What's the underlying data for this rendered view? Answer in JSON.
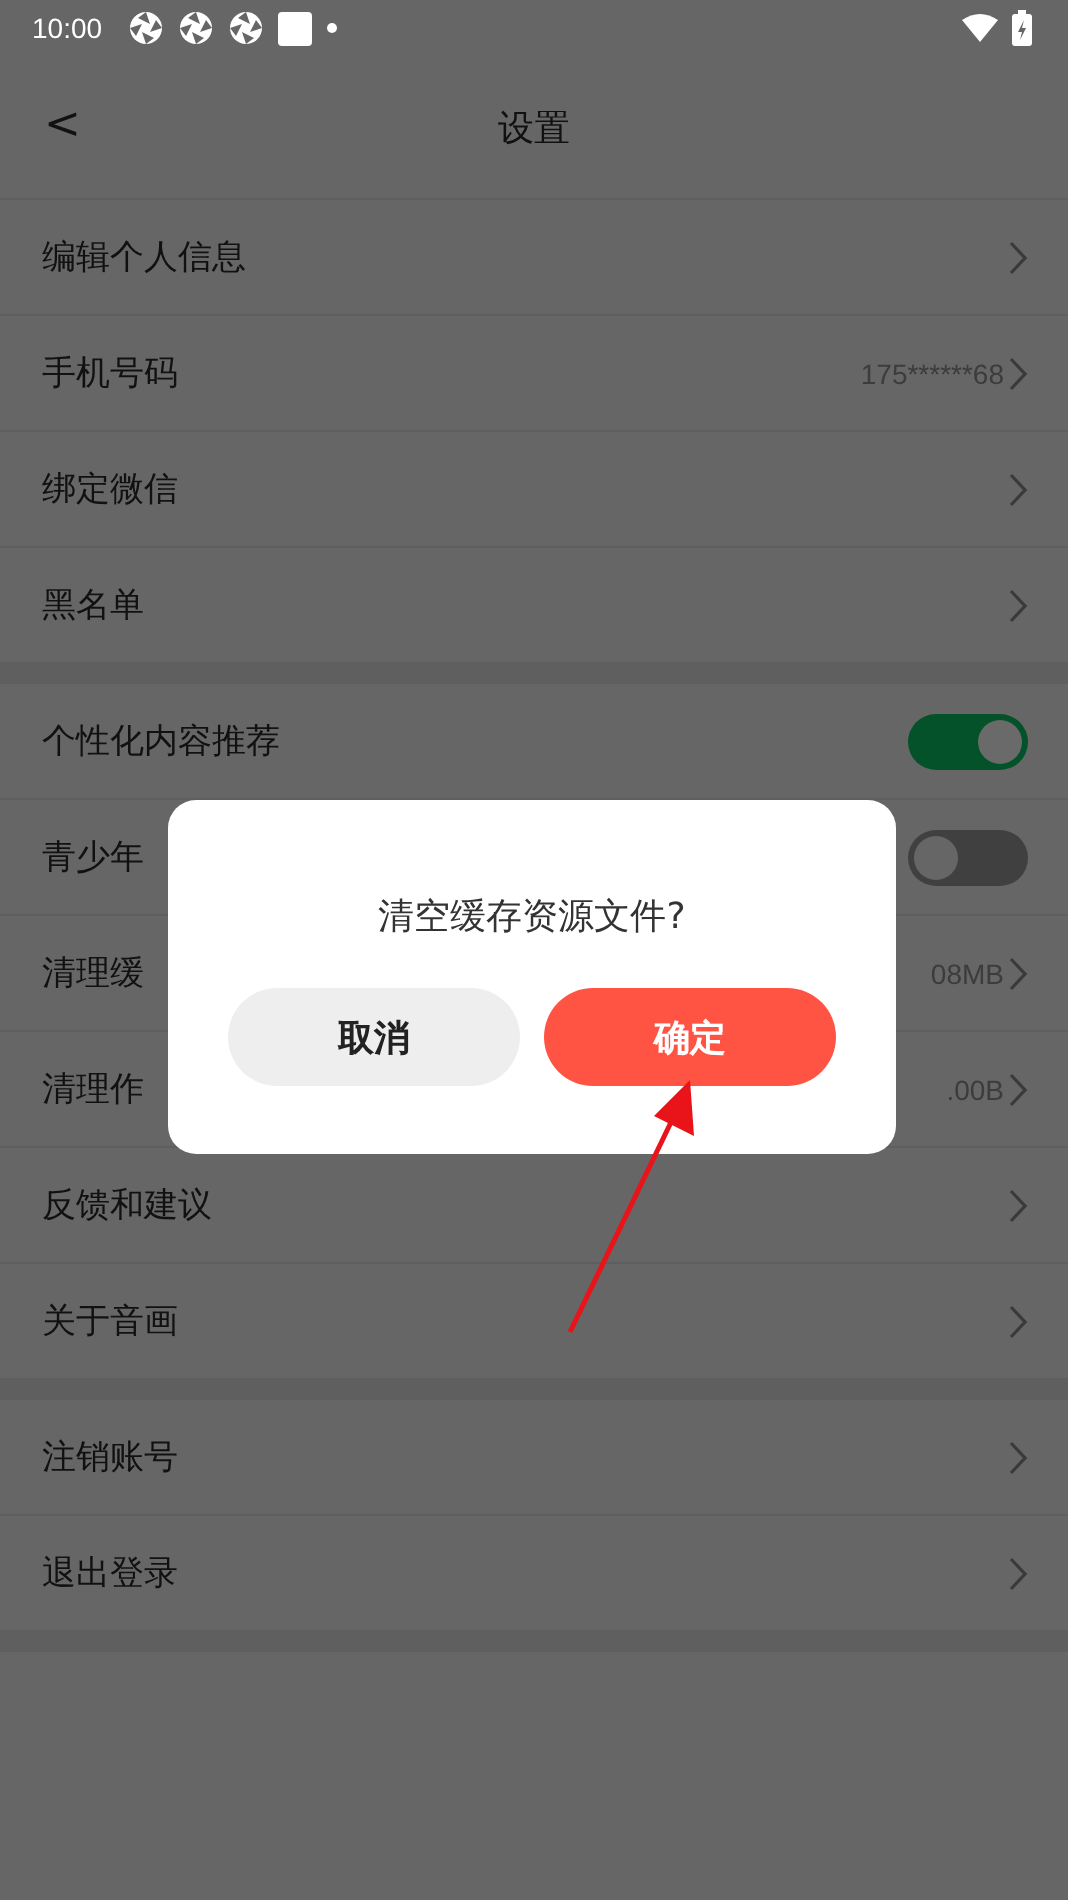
{
  "status_bar": {
    "time": "10:00"
  },
  "header": {
    "back": "<",
    "title": "设置"
  },
  "sections": [
    {
      "rows": [
        {
          "kind": "link",
          "label": "编辑个人信息"
        },
        {
          "kind": "link",
          "label": "手机号码",
          "value": "175******68"
        },
        {
          "kind": "link",
          "label": "绑定微信"
        },
        {
          "kind": "link",
          "label": "黑名单"
        }
      ]
    },
    {
      "rows": [
        {
          "kind": "toggle",
          "label": "个性化内容推荐",
          "on": true
        },
        {
          "kind": "toggle",
          "label": "青少年",
          "on": false
        },
        {
          "kind": "link",
          "label": "清理缓",
          "value": "08MB"
        },
        {
          "kind": "link",
          "label": "清理作",
          "value": ".00B"
        },
        {
          "kind": "link",
          "label": "反馈和建议"
        },
        {
          "kind": "link",
          "label": "关于音画"
        }
      ]
    },
    {
      "rows": [
        {
          "kind": "link",
          "label": "注销账号"
        },
        {
          "kind": "link",
          "label": "退出登录"
        }
      ]
    }
  ],
  "dialog": {
    "message": "清空缓存资源文件?",
    "buttons": [
      {
        "label": "取消",
        "kind": "cancel"
      },
      {
        "label": "确定",
        "kind": "confirm"
      }
    ]
  }
}
